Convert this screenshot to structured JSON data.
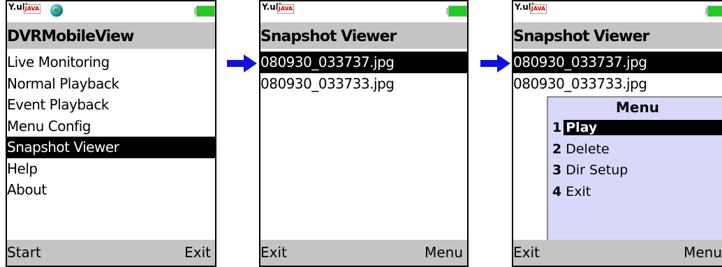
{
  "screens": [
    {
      "title": "DVRMobileView",
      "items": [
        "Live Monitoring",
        "Normal Playback",
        "Event Playback",
        "Menu Config",
        "Snapshot Viewer",
        "Help",
        "About"
      ],
      "selected_index": 4,
      "soft_left": "Start",
      "soft_right": "Exit"
    },
    {
      "title": "Snapshot Viewer",
      "items": [
        "080930_033737.jpg",
        "080930_033733.jpg"
      ],
      "selected_index": 0,
      "soft_left": "Exit",
      "soft_right": "Menu"
    },
    {
      "title": "Snapshot Viewer",
      "items": [
        "080930_033737.jpg",
        "080930_033733.jpg"
      ],
      "selected_index": 0,
      "soft_left": "Exit",
      "soft_right": "Menu",
      "menu": {
        "title": "Menu",
        "items": [
          {
            "num": "1",
            "label": "Play"
          },
          {
            "num": "2",
            "label": "Delete"
          },
          {
            "num": "3",
            "label": "Dir Setup"
          },
          {
            "num": "4",
            "label": "Exit"
          }
        ],
        "selected_index": 0
      }
    }
  ],
  "status": {
    "signal": "Y.ull",
    "java_badge": "JAVA"
  },
  "colors": {
    "arrow": "#1010e0",
    "title_bar": "#c4c4c4",
    "menu_bg": "#d8d8f8",
    "battery": "#22cc22"
  }
}
